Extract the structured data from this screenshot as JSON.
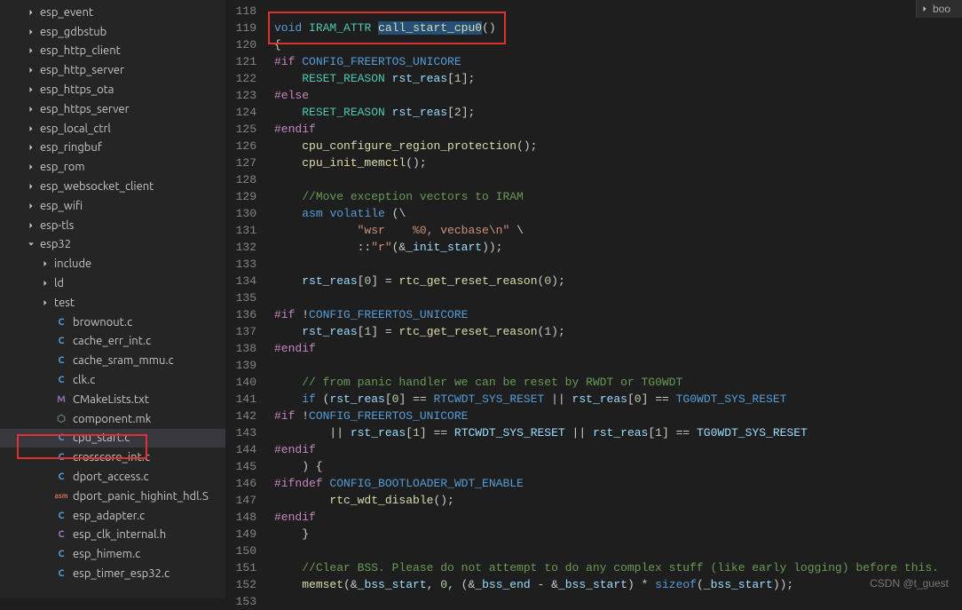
{
  "sidebar": {
    "items": [
      {
        "indent": 28,
        "chev": "right",
        "icon": "",
        "label": "esp_event"
      },
      {
        "indent": 28,
        "chev": "right",
        "icon": "",
        "label": "esp_gdbstub"
      },
      {
        "indent": 28,
        "chev": "right",
        "icon": "",
        "label": "esp_http_client"
      },
      {
        "indent": 28,
        "chev": "right",
        "icon": "",
        "label": "esp_http_server"
      },
      {
        "indent": 28,
        "chev": "right",
        "icon": "",
        "label": "esp_https_ota"
      },
      {
        "indent": 28,
        "chev": "right",
        "icon": "",
        "label": "esp_https_server"
      },
      {
        "indent": 28,
        "chev": "right",
        "icon": "",
        "label": "esp_local_ctrl"
      },
      {
        "indent": 28,
        "chev": "right",
        "icon": "",
        "label": "esp_ringbuf"
      },
      {
        "indent": 28,
        "chev": "right",
        "icon": "",
        "label": "esp_rom"
      },
      {
        "indent": 28,
        "chev": "right",
        "icon": "",
        "label": "esp_websocket_client"
      },
      {
        "indent": 28,
        "chev": "right",
        "icon": "",
        "label": "esp_wifi"
      },
      {
        "indent": 28,
        "chev": "right",
        "icon": "",
        "label": "esp-tls"
      },
      {
        "indent": 28,
        "chev": "down",
        "icon": "",
        "label": "esp32"
      },
      {
        "indent": 44,
        "chev": "right",
        "icon": "",
        "label": "include"
      },
      {
        "indent": 44,
        "chev": "right",
        "icon": "",
        "label": "ld"
      },
      {
        "indent": 44,
        "chev": "right",
        "icon": "",
        "label": "test"
      },
      {
        "indent": 44,
        "chev": "",
        "icon": "C",
        "cls": "c",
        "label": "brownout.c"
      },
      {
        "indent": 44,
        "chev": "",
        "icon": "C",
        "cls": "c",
        "label": "cache_err_int.c"
      },
      {
        "indent": 44,
        "chev": "",
        "icon": "C",
        "cls": "c",
        "label": "cache_sram_mmu.c"
      },
      {
        "indent": 44,
        "chev": "",
        "icon": "C",
        "cls": "c",
        "label": "clk.c"
      },
      {
        "indent": 44,
        "chev": "",
        "icon": "M",
        "cls": "m",
        "label": "CMakeLists.txt"
      },
      {
        "indent": 44,
        "chev": "",
        "icon": "⬡",
        "cls": "mk",
        "label": "component.mk"
      },
      {
        "indent": 44,
        "chev": "",
        "icon": "C",
        "cls": "c",
        "label": "cpu_start.c",
        "selected": true
      },
      {
        "indent": 44,
        "chev": "",
        "icon": "C",
        "cls": "c",
        "label": "crosscore_int.c"
      },
      {
        "indent": 44,
        "chev": "",
        "icon": "C",
        "cls": "c",
        "label": "dport_access.c"
      },
      {
        "indent": 44,
        "chev": "",
        "icon": "asm",
        "cls": "asm",
        "label": "dport_panic_highint_hdl.S"
      },
      {
        "indent": 44,
        "chev": "",
        "icon": "C",
        "cls": "c",
        "label": "esp_adapter.c"
      },
      {
        "indent": 44,
        "chev": "",
        "icon": "C",
        "cls": "h",
        "label": "esp_clk_internal.h"
      },
      {
        "indent": 44,
        "chev": "",
        "icon": "C",
        "cls": "c",
        "label": "esp_himem.c"
      },
      {
        "indent": 44,
        "chev": "",
        "icon": "C",
        "cls": "c",
        "label": "esp_timer_esp32.c"
      }
    ]
  },
  "gutter": {
    "start": 118,
    "end": 153
  },
  "rightPane": {
    "label": "boo"
  },
  "watermark": "CSDN @t_guest",
  "code": [
    {
      "n": 118,
      "html": ""
    },
    {
      "n": 119,
      "html": "<span class='kw'>void</span> <span class='type'>IRAM_ATTR</span> <span class='fn sel'>call_start_cpu0</span>()"
    },
    {
      "n": 120,
      "html": "{"
    },
    {
      "n": 121,
      "html": "<span class='pre'>#if</span> <span class='mac'>CONFIG_FREERTOS_UNICORE</span>"
    },
    {
      "n": 122,
      "html": "    <span class='type'>RESET_REASON</span> <span class='id'>rst_reas</span>[<span class='num'>1</span>];"
    },
    {
      "n": 123,
      "html": "<span class='pre'>#else</span>"
    },
    {
      "n": 124,
      "html": "    <span class='type'>RESET_REASON</span> <span class='id'>rst_reas</span>[<span class='num'>2</span>];"
    },
    {
      "n": 125,
      "html": "<span class='pre'>#endif</span>"
    },
    {
      "n": 126,
      "html": "    <span class='fn'>cpu_configure_region_protection</span>();"
    },
    {
      "n": 127,
      "html": "    <span class='fn'>cpu_init_memctl</span>();"
    },
    {
      "n": 128,
      "html": ""
    },
    {
      "n": 129,
      "html": "    <span class='com'>//Move exception vectors to IRAM</span>"
    },
    {
      "n": 130,
      "html": "    <span class='kw'>asm</span> <span class='kw'>volatile</span> (\\"
    },
    {
      "n": 131,
      "html": "            <span class='str'>\"wsr    %0, vecbase\\n\"</span> \\"
    },
    {
      "n": 132,
      "html": "            ::<span class='str'>\"r\"</span>(&amp;<span class='id'>_init_start</span>));"
    },
    {
      "n": 133,
      "html": ""
    },
    {
      "n": 134,
      "html": "    <span class='id'>rst_reas</span>[<span class='num'>0</span>] = <span class='fn'>rtc_get_reset_reason</span>(<span class='num'>0</span>);"
    },
    {
      "n": 135,
      "html": ""
    },
    {
      "n": 136,
      "html": "<span class='pre'>#if</span> !<span class='mac'>CONFIG_FREERTOS_UNICORE</span>"
    },
    {
      "n": 137,
      "html": "    <span class='id'>rst_reas</span>[<span class='num'>1</span>] = <span class='fn'>rtc_get_reset_reason</span>(<span class='num'>1</span>);"
    },
    {
      "n": 138,
      "html": "<span class='pre'>#endif</span>"
    },
    {
      "n": 139,
      "html": ""
    },
    {
      "n": 140,
      "html": "    <span class='com'>// from panic handler we can be reset by RWDT or TG0WDT</span>"
    },
    {
      "n": 141,
      "html": "    <span class='kw'>if</span> (<span class='id'>rst_reas</span>[<span class='num'>0</span>] == <span class='mac'>RTCWDT_SYS_RESET</span> || <span class='id'>rst_reas</span>[<span class='num'>0</span>] == <span class='mac'>TG0WDT_SYS_RESET</span>"
    },
    {
      "n": 142,
      "html": "<span class='pre'>#if</span> !<span class='mac'>CONFIG_FREERTOS_UNICORE</span>"
    },
    {
      "n": 143,
      "html": "        || <span class='id'>rst_reas</span>[<span class='num'>1</span>] == <span class='id'>RTCWDT_SYS_RESET</span> || <span class='id'>rst_reas</span>[<span class='num'>1</span>] == <span class='id'>TG0WDT_SYS_RESET</span>"
    },
    {
      "n": 144,
      "html": "<span class='pre'>#endif</span>"
    },
    {
      "n": 145,
      "html": "    ) {"
    },
    {
      "n": 146,
      "html": "<span class='pre'>#ifndef</span> <span class='mac'>CONFIG_BOOTLOADER_WDT_ENABLE</span>"
    },
    {
      "n": 147,
      "html": "        <span class='fn'>rtc_wdt_disable</span>();"
    },
    {
      "n": 148,
      "html": "<span class='pre'>#endif</span>"
    },
    {
      "n": 149,
      "html": "    }"
    },
    {
      "n": 150,
      "html": ""
    },
    {
      "n": 151,
      "html": "    <span class='com'>//Clear BSS. Please do not attempt to do any complex stuff (like early logging) before this.</span>"
    },
    {
      "n": 152,
      "html": "    <span class='fn'>memset</span>(&amp;<span class='id'>_bss_start</span>, <span class='num'>0</span>, (&amp;<span class='id'>_bss_end</span> - &amp;<span class='id'>_bss_start</span>) * <span class='kw'>sizeof</span>(<span class='id'>_bss_start</span>));"
    },
    {
      "n": 153,
      "html": ""
    }
  ]
}
